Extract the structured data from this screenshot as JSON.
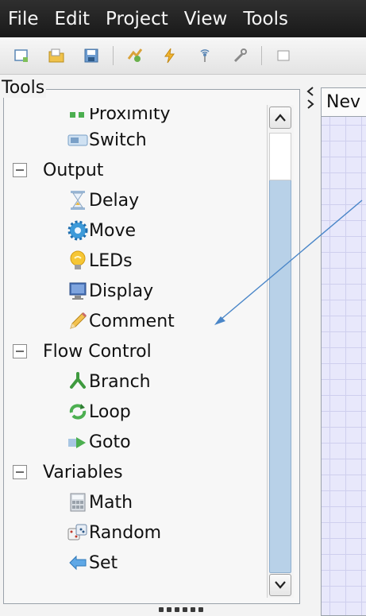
{
  "menubar": {
    "items": [
      "File",
      "Edit",
      "Project",
      "View",
      "Tools"
    ]
  },
  "toolbar": {
    "icons": [
      "new-project-icon",
      "open-icon",
      "save-icon",
      "build-icon",
      "flash-icon",
      "wireless-icon",
      "tools-icon",
      "extra-icon"
    ]
  },
  "tools_panel": {
    "title": "Tools",
    "rows": [
      {
        "type": "item",
        "label": "Proximity",
        "icon": "proximity-icon"
      },
      {
        "type": "item",
        "label": "Switch",
        "icon": "switch-icon"
      },
      {
        "type": "category",
        "label": "Output"
      },
      {
        "type": "item",
        "label": "Delay",
        "icon": "hourglass-icon"
      },
      {
        "type": "item",
        "label": "Move",
        "icon": "gear-icon"
      },
      {
        "type": "item",
        "label": "LEDs",
        "icon": "bulb-icon"
      },
      {
        "type": "item",
        "label": "Display",
        "icon": "monitor-icon"
      },
      {
        "type": "item",
        "label": "Comment",
        "icon": "pencil-icon"
      },
      {
        "type": "category",
        "label": "Flow Control"
      },
      {
        "type": "item",
        "label": "Branch",
        "icon": "branch-icon"
      },
      {
        "type": "item",
        "label": "Loop",
        "icon": "loop-icon"
      },
      {
        "type": "item",
        "label": "Goto",
        "icon": "goto-arrow-icon"
      },
      {
        "type": "category",
        "label": "Variables"
      },
      {
        "type": "item",
        "label": "Math",
        "icon": "calculator-icon"
      },
      {
        "type": "item",
        "label": "Random",
        "icon": "dice-icon"
      },
      {
        "type": "item",
        "label": "Set",
        "icon": "set-arrow-icon"
      }
    ]
  },
  "editor": {
    "tab_label": "Nev"
  },
  "colors": {
    "menubar_bg": "#1f1f1f",
    "scroll_thumb": "#b8d1e8",
    "canvas_bg": "#e8e8fb",
    "annotation_arrow": "#4a86c8"
  }
}
